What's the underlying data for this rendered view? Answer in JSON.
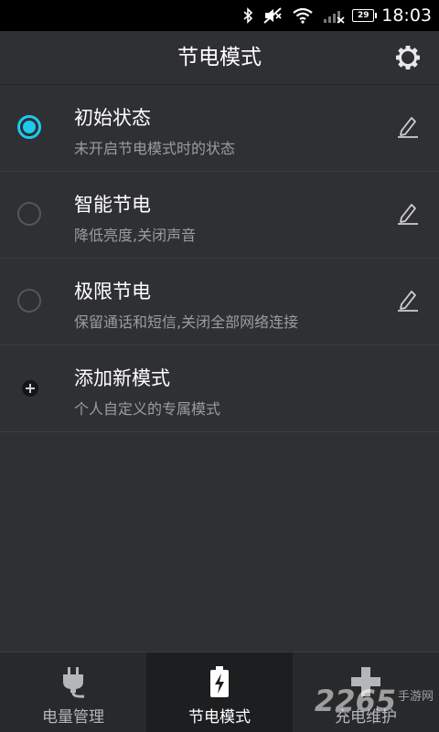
{
  "status_bar": {
    "battery_level": "29",
    "time": "18:03",
    "icons": [
      "bluetooth-icon",
      "mute-icon",
      "wifi-icon",
      "signal-icon",
      "battery-icon"
    ]
  },
  "header": {
    "title": "节电模式",
    "settings_icon": "gear-icon"
  },
  "modes": [
    {
      "name": "初始状态",
      "description": "未开启节电模式时的状态",
      "selected": true,
      "editable": true
    },
    {
      "name": "智能节电",
      "description": "降低亮度,关闭声音",
      "selected": false,
      "editable": true
    },
    {
      "name": "极限节电",
      "description": "保留通话和短信,关闭全部网络连接",
      "selected": false,
      "editable": true
    }
  ],
  "add_mode": {
    "name": "添加新模式",
    "description": "个人自定义的专属模式",
    "icon": "plus-circle-icon"
  },
  "bottom_nav": {
    "tabs": [
      {
        "label": "电量管理",
        "icon": "plug-icon",
        "active": false
      },
      {
        "label": "节电模式",
        "icon": "battery-bolt-icon",
        "active": true
      },
      {
        "label": "充电维护",
        "icon": "plus-icon",
        "active": false
      }
    ]
  },
  "watermark": {
    "number": "2265",
    "text": "手游网"
  },
  "colors": {
    "accent": "#1ec9ee",
    "background": "#2f3033",
    "nav_background": "#28292b",
    "nav_active": "#1d1e20",
    "secondary_text": "#9b9ca0"
  }
}
